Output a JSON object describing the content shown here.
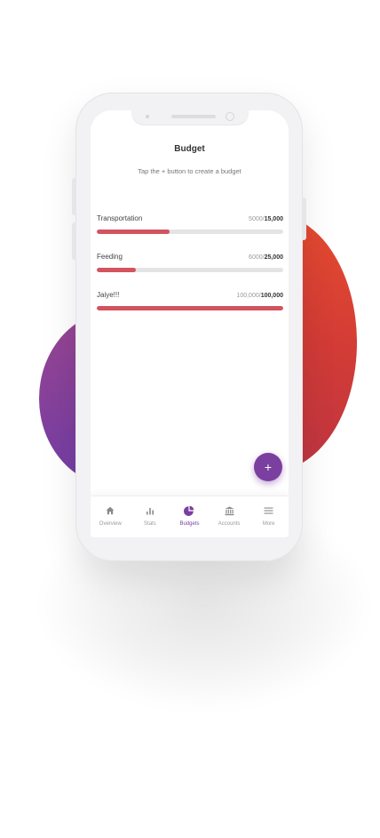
{
  "screen": {
    "title": "Budget",
    "hint": "Tap the + button to create a budget"
  },
  "budgets": [
    {
      "name": "Transportation",
      "spent": "5000",
      "limit": "15,000",
      "progress": 0.39
    },
    {
      "name": "Feeding",
      "spent": "6000",
      "limit": "25,000",
      "progress": 0.21
    },
    {
      "name": "Jaiye!!!",
      "spent": "100,000",
      "limit": "100,000",
      "progress": 1.0
    }
  ],
  "fab": {
    "label": "+"
  },
  "tabs": [
    {
      "label": "Overview",
      "icon": "home-icon"
    },
    {
      "label": "Stats",
      "icon": "bar-chart-icon"
    },
    {
      "label": "Budgets",
      "icon": "pie-chart-icon",
      "active": true
    },
    {
      "label": "Accounts",
      "icon": "bank-icon"
    },
    {
      "label": "More",
      "icon": "menu-icon"
    }
  ],
  "colors": {
    "accent": "#7b3fa0",
    "progress_bar": "#d3535e",
    "track": "#e4e4e6",
    "blob_left": "#8a4298",
    "blob_right": "#d63d35"
  }
}
